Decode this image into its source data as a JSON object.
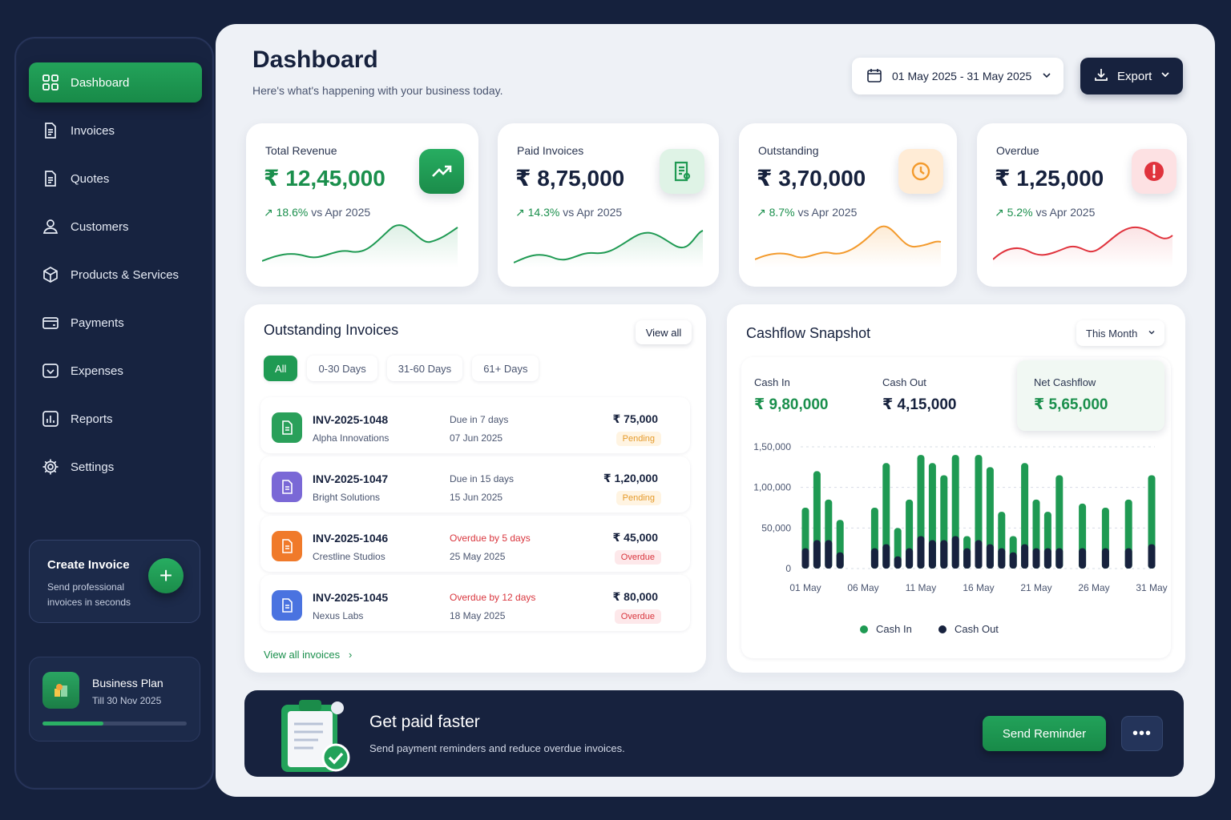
{
  "sidebar": {
    "items": [
      {
        "label": "Dashboard",
        "icon": "grid-icon",
        "active": true
      },
      {
        "label": "Invoices",
        "icon": "invoice-icon"
      },
      {
        "label": "Quotes",
        "icon": "quote-icon"
      },
      {
        "label": "Customers",
        "icon": "user-icon"
      },
      {
        "label": "Products & Services",
        "icon": "box-icon"
      },
      {
        "label": "Payments",
        "icon": "card-icon"
      },
      {
        "label": "Expenses",
        "icon": "wallet-icon"
      },
      {
        "label": "Reports",
        "icon": "bar-chart-icon"
      },
      {
        "label": "Settings",
        "icon": "gear-icon"
      }
    ],
    "create": {
      "title": "Create Invoice",
      "subtitle": "Send professional invoices in seconds"
    },
    "plan": {
      "name": "Business Plan",
      "date": "Till 30 Nov 2025",
      "progress": 0.42
    }
  },
  "header": {
    "title": "Dashboard",
    "subtitle": "Here's what's happening with your business today.",
    "date_range": "01 May 2025 - 31 May 2025",
    "export_label": "Export"
  },
  "stats": [
    {
      "label": "Total Revenue",
      "value": "₹ 12,45,000",
      "change": "18.6%",
      "compare": "vs Apr 2025",
      "icon": "trend-up-icon",
      "color": "#1f9a53"
    },
    {
      "label": "Paid Invoices",
      "value": "₹ 8,75,000",
      "change": "14.3%",
      "compare": "vs Apr 2025",
      "icon": "paid-invoice-icon",
      "color": "#1f9a53"
    },
    {
      "label": "Outstanding",
      "value": "₹ 3,70,000",
      "change": "8.7%",
      "compare": "vs Apr 2025",
      "icon": "clock-icon",
      "color": "#f39a2c"
    },
    {
      "label": "Overdue",
      "value": "₹ 1,25,000",
      "change": "5.2%",
      "compare": "vs Apr 2025",
      "icon": "alert-icon",
      "color": "#e0333d"
    }
  ],
  "outstanding": {
    "title": "Outstanding Invoices",
    "view_all": "View all",
    "filters": [
      "All",
      "0-30 Days",
      "31-60 Days",
      "61+ Days"
    ],
    "rows": [
      {
        "number": "INV-2025-1048",
        "client": "Alpha Innovations",
        "due": "Due in 7 days",
        "date": "07 Jun 2025",
        "amount": "₹ 75,000",
        "status": "Pending",
        "color": "#2aa05a"
      },
      {
        "number": "INV-2025-1047",
        "client": "Bright Solutions",
        "due": "Due in 15 days",
        "date": "15 Jun 2025",
        "amount": "₹ 1,20,000",
        "status": "Pending",
        "color": "#7a68d6"
      },
      {
        "number": "INV-2025-1046",
        "client": "Crestline Studios",
        "due": "Overdue by 5 days",
        "date": "25 May 2025",
        "amount": "₹ 45,000",
        "status": "Overdue",
        "color": "#f07a2a"
      },
      {
        "number": "INV-2025-1045",
        "client": "Nexus Labs",
        "due": "Overdue by 12 days",
        "date": "18 May 2025",
        "amount": "₹ 80,000",
        "status": "Overdue",
        "color": "#4a73e0"
      }
    ],
    "view_all_link": "View all invoices"
  },
  "cashflow": {
    "title": "Cashflow Snapshot",
    "period": "This Month",
    "cash_in_label": "Cash In",
    "cash_in": "₹ 9,80,000",
    "cash_out_label": "Cash Out",
    "cash_out": "₹ 4,15,000",
    "net_label": "Net Cashflow",
    "net": "₹ 5,65,000"
  },
  "chart_data": {
    "type": "bar",
    "categories": [
      "01 May",
      "02 May",
      "03 May",
      "04 May",
      "05 May",
      "06 May",
      "07 May",
      "08 May",
      "09 May",
      "10 May",
      "11 May",
      "12 May",
      "13 May",
      "14 May",
      "15 May",
      "16 May",
      "17 May",
      "18 May",
      "19 May",
      "20 May",
      "21 May",
      "22 May",
      "23 May",
      "24 May",
      "25 May",
      "26 May",
      "27 May",
      "28 May",
      "29 May",
      "30 May",
      "31 May"
    ],
    "x_tick_labels": [
      "01 May",
      "06 May",
      "11 May",
      "16 May",
      "21 May",
      "26 May",
      "31 May"
    ],
    "series": [
      {
        "name": "Cash In",
        "values": [
          75000,
          120000,
          85000,
          60000,
          0,
          0,
          75000,
          130000,
          50000,
          85000,
          140000,
          130000,
          115000,
          140000,
          40000,
          140000,
          125000,
          70000,
          40000,
          130000,
          85000,
          70000,
          115000,
          0,
          80000,
          0,
          75000,
          0,
          85000,
          0,
          115000
        ]
      },
      {
        "name": "Cash Out",
        "values": [
          25000,
          35000,
          35000,
          20000,
          0,
          0,
          25000,
          30000,
          15000,
          25000,
          40000,
          35000,
          35000,
          40000,
          25000,
          35000,
          30000,
          25000,
          20000,
          30000,
          25000,
          25000,
          25000,
          0,
          25000,
          0,
          25000,
          0,
          25000,
          0,
          30000
        ]
      }
    ],
    "ylim": [
      0,
      150000
    ],
    "y_ticks": [
      "0",
      "50,000",
      "1,00,000",
      "1,50,000"
    ],
    "grid": true,
    "legend": "bottom"
  },
  "banner": {
    "title": "Get paid faster",
    "subtitle": "Send payment reminders and reduce overdue invoices.",
    "button": "Send Reminder",
    "more": "•••"
  }
}
